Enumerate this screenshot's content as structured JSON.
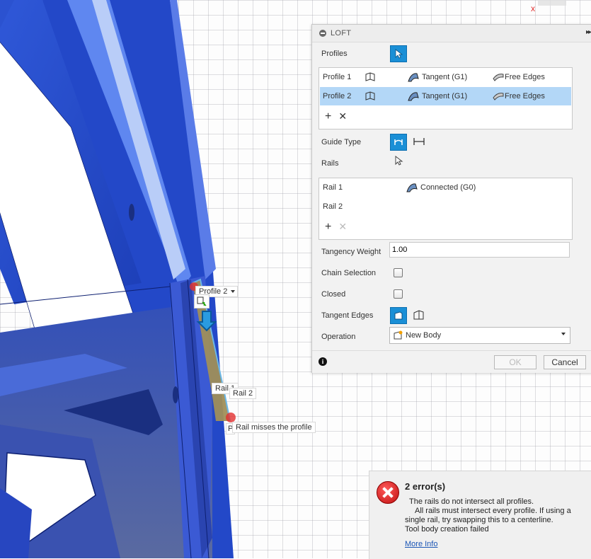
{
  "viewport": {
    "labels": {
      "profile2_dropdown": "Profile 2",
      "profile_hint": "P",
      "rail1": "Rail 1",
      "rail2": "Rail 2",
      "rail_error": "Rail misses the profile"
    }
  },
  "loft": {
    "title": "LOFT",
    "expand_icon_text": "▸▸",
    "profiles_label": "Profiles",
    "profiles": [
      {
        "name": "Profile 1",
        "condition": "Tangent (G1)",
        "edges": "Free Edges",
        "selected": false
      },
      {
        "name": "Profile 2",
        "condition": "Tangent (G1)",
        "edges": "Free Edges",
        "selected": true
      }
    ],
    "guide_type_label": "Guide Type",
    "rails_label": "Rails",
    "rails": [
      {
        "name": "Rail 1",
        "condition": "Connected (G0)"
      },
      {
        "name": "Rail 2",
        "condition": ""
      }
    ],
    "tangency_weight_label": "Tangency Weight",
    "tangency_weight_value": "1.00",
    "chain_selection_label": "Chain Selection",
    "closed_label": "Closed",
    "tangent_edges_label": "Tangent Edges",
    "operation_label": "Operation",
    "operation_value": "New Body",
    "ok_label": "OK",
    "cancel_label": "Cancel",
    "accent_color": "#1a8fd6"
  },
  "error": {
    "title": "2 error(s)",
    "line1": "The rails do not intersect all profiles.",
    "line2": "All rails must intersect every profile. If using a",
    "line3": "single rail, try swapping this to a centerline.",
    "line4": "Tool body creation failed",
    "more_info": "More Info"
  }
}
